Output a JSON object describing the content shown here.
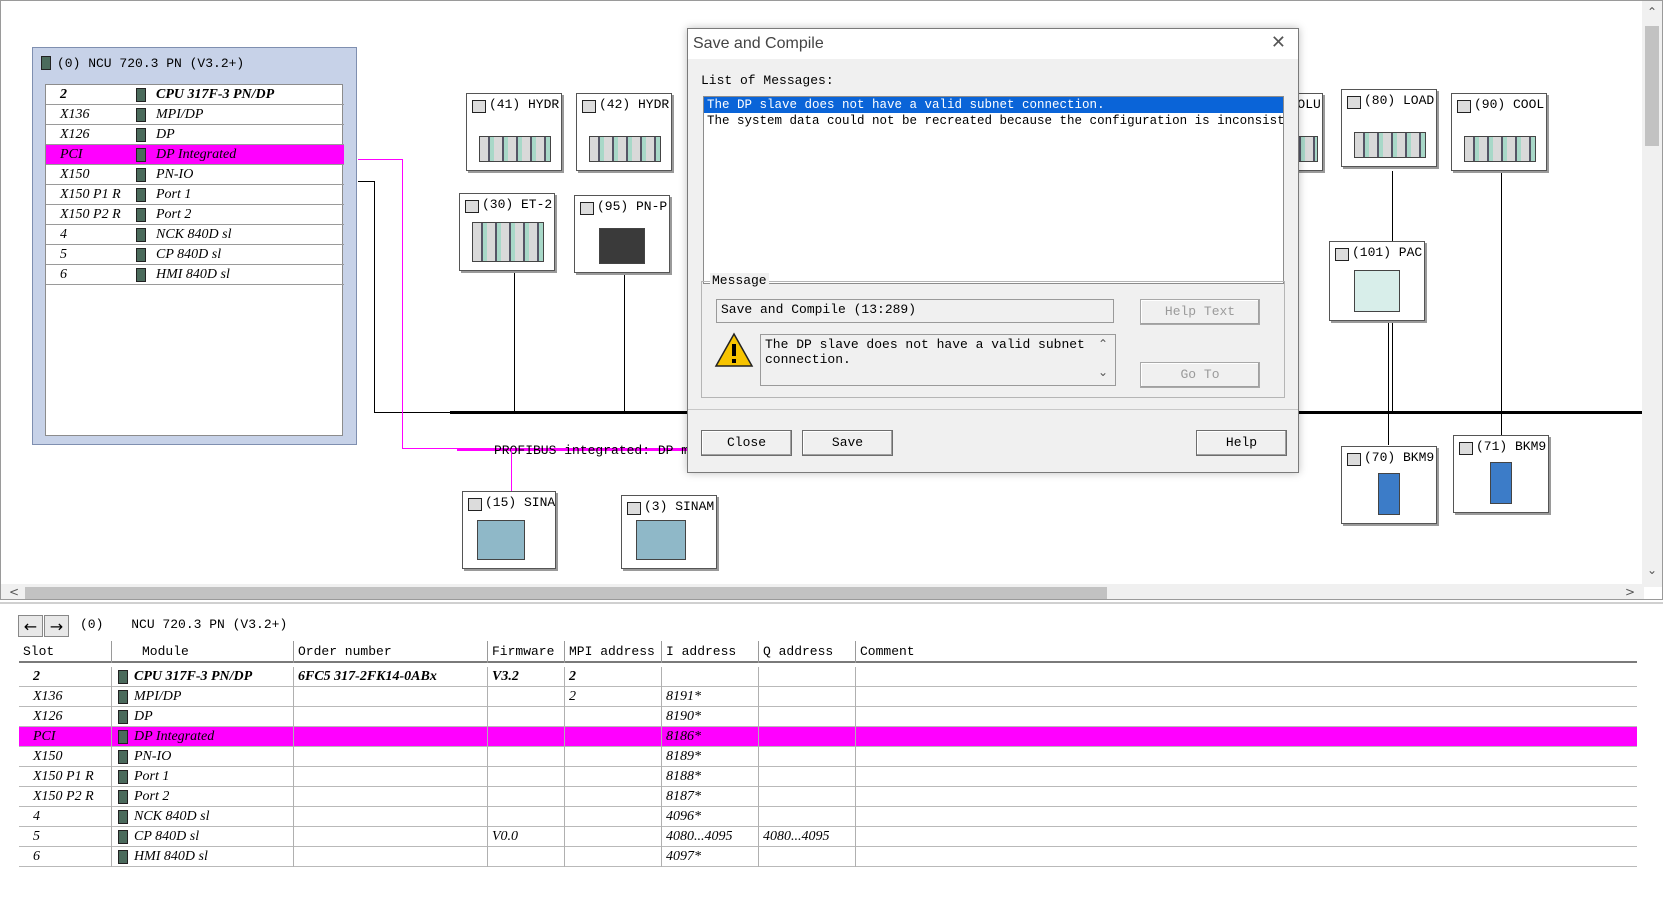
{
  "rack": {
    "title": "(0) NCU 720.3 PN (V3.2+)",
    "rows": [
      {
        "slot": "2",
        "module": "CPU 317F-3 PN/DP"
      },
      {
        "slot": "X136",
        "module": "MPI/DP"
      },
      {
        "slot": "X126",
        "module": "DP"
      },
      {
        "slot": "PCI",
        "module": "DP Integrated"
      },
      {
        "slot": "X150",
        "module": "PN-IO"
      },
      {
        "slot": "X150 P1 R",
        "module": "Port 1"
      },
      {
        "slot": "X150 P2 R",
        "module": "Port 2"
      },
      {
        "slot": "4",
        "module": "NCK 840D sl"
      },
      {
        "slot": "5",
        "module": "CP 840D sl"
      },
      {
        "slot": "6",
        "module": "HMI 840D sl"
      }
    ]
  },
  "devices": {
    "d41": "(41) HYDR",
    "d42": "(42) HYDR",
    "d30": "(30) ET-2",
    "d95": "(95) PN-P",
    "dcolu": ") COLU",
    "d80": "(80) LOAD",
    "d90": "(90) COOL",
    "d101": "(101) PAC",
    "d70": "(70) BKM9",
    "d71": "(71) BKM9",
    "d15": "(15) SINA",
    "d3": "(3) SINAM"
  },
  "profibus_label": "PROFIBUS integrated: DP ma",
  "dialog": {
    "title": "Save and Compile",
    "list_label": "List of Messages:",
    "messages": [
      "The DP slave   does not have a valid subnet connection.",
      "The system data could not be recreated because the configuration is inconsistent."
    ],
    "message_group": "Message",
    "message_code": "Save and Compile (13:289)",
    "message_text": "The DP slave   does not have a valid subnet connection.",
    "help_text_button": "Help Text",
    "goto_button": "Go To",
    "close_button": "Close",
    "save_button": "Save",
    "help_button": "Help"
  },
  "table": {
    "title_index": "(0)",
    "title": "NCU 720.3 PN (V3.2+)",
    "headers": {
      "slot": "Slot",
      "module": "Module",
      "order": "Order number",
      "firmware": "Firmware",
      "mpi": "MPI address",
      "iaddr": "I address",
      "qaddr": "Q address",
      "comment": "Comment"
    },
    "rows": [
      {
        "slot": "2",
        "module": "CPU 317F-3 PN/DP",
        "order": "6FC5 317-2FK14-0ABx",
        "firmware": "V3.2",
        "mpi": "2",
        "iaddr": "",
        "qaddr": "",
        "comment": ""
      },
      {
        "slot": "X136",
        "module": "MPI/DP",
        "order": "",
        "firmware": "",
        "mpi": "2",
        "iaddr": "8191*",
        "qaddr": "",
        "comment": ""
      },
      {
        "slot": "X126",
        "module": "DP",
        "order": "",
        "firmware": "",
        "mpi": "",
        "iaddr": "8190*",
        "qaddr": "",
        "comment": ""
      },
      {
        "slot": "PCI",
        "module": "DP Integrated",
        "order": "",
        "firmware": "",
        "mpi": "",
        "iaddr": "8186*",
        "qaddr": "",
        "comment": ""
      },
      {
        "slot": "X150",
        "module": "PN-IO",
        "order": "",
        "firmware": "",
        "mpi": "",
        "iaddr": "8189*",
        "qaddr": "",
        "comment": ""
      },
      {
        "slot": "X150 P1 R",
        "module": "Port 1",
        "order": "",
        "firmware": "",
        "mpi": "",
        "iaddr": "8188*",
        "qaddr": "",
        "comment": ""
      },
      {
        "slot": "X150 P2 R",
        "module": "Port 2",
        "order": "",
        "firmware": "",
        "mpi": "",
        "iaddr": "8187*",
        "qaddr": "",
        "comment": ""
      },
      {
        "slot": "4",
        "module": "NCK 840D sl",
        "order": "",
        "firmware": "",
        "mpi": "",
        "iaddr": "4096*",
        "qaddr": "",
        "comment": ""
      },
      {
        "slot": "5",
        "module": "CP 840D sl",
        "order": "",
        "firmware": "V0.0",
        "mpi": "",
        "iaddr": "4080...4095",
        "qaddr": "4080...4095",
        "comment": ""
      },
      {
        "slot": "6",
        "module": "HMI 840D sl",
        "order": "",
        "firmware": "",
        "mpi": "",
        "iaddr": "4097*",
        "qaddr": "",
        "comment": ""
      }
    ]
  },
  "colors": {
    "highlight": "#ff00ff",
    "selection": "#0a64d8",
    "rack_bg": "#c7d2e8"
  }
}
